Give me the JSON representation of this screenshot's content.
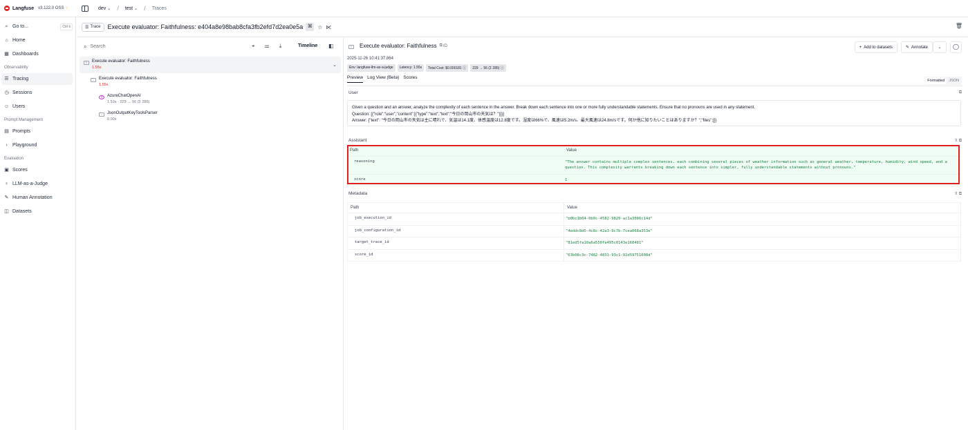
{
  "app": {
    "name": "Langfuse",
    "version": "v3.122.0 OSS",
    "version_dot": "↑",
    "breadcrumb": {
      "project": "dev",
      "env": "test",
      "page": "Traces"
    }
  },
  "sidebar": {
    "goto": {
      "label": "Go to...",
      "shortcut": "Ctrl k"
    },
    "top": [
      {
        "label": "Home",
        "icon": "home-icon"
      },
      {
        "label": "Dashboards",
        "icon": "dashboard-icon"
      }
    ],
    "sections": [
      {
        "title": "Observability",
        "items": [
          {
            "label": "Tracing",
            "icon": "tracing-icon",
            "active": true
          },
          {
            "label": "Sessions",
            "icon": "sessions-icon"
          },
          {
            "label": "Users",
            "icon": "users-icon"
          }
        ]
      },
      {
        "title": "Prompt Management",
        "items": [
          {
            "label": "Prompts",
            "icon": "prompts-icon"
          },
          {
            "label": "Playground",
            "icon": "playground-icon"
          }
        ]
      },
      {
        "title": "Evaluation",
        "items": [
          {
            "label": "Scores",
            "icon": "scores-icon"
          },
          {
            "label": "LLM-as-a-Judge",
            "icon": "judge-icon"
          },
          {
            "label": "Human Annotation",
            "icon": "annotation-icon"
          },
          {
            "label": "Datasets",
            "icon": "datasets-icon"
          }
        ]
      }
    ]
  },
  "trace": {
    "badge": "Trace",
    "title": "Execute evaluator: Faithfulness: e404a8e98bab8cfa3fb2efd7d2ea0e5a"
  },
  "tree": {
    "search_placeholder": "Search",
    "timeline_label": "Timeline",
    "nodes": [
      {
        "name": "Execute evaluator: Faithfulness",
        "meta": "1.55s"
      },
      {
        "name": "Execute evaluator: Faithfulness",
        "meta": "1.55s"
      },
      {
        "name": "AzureChatOpenAI",
        "meta": "1.53s · 229 → 56 (Σ 285)"
      },
      {
        "name": "JsonOutputKeyToolsParser",
        "meta": "0.00s"
      }
    ]
  },
  "detail": {
    "title": "Execute evaluator: Faithfulness",
    "title_suffix": "ID",
    "timestamp": "2025-11-26 10:41:37.864",
    "chips": [
      "Env: langfuse-llm-as-a-judge",
      "Latency: 1.55s",
      "Total Cost: $0.000181 ⓘ",
      "229 → 56 (Σ 285) ⓘ"
    ],
    "buttons": {
      "add_to_datasets": "Add to datasets",
      "annotate": "Annotate"
    },
    "tabs": [
      "Preview",
      "Log View (Beta)",
      "Scores"
    ],
    "format": {
      "formatted": "Formatted",
      "json": "JSON"
    },
    "user": {
      "label": "User",
      "line1": "Given a question and an answer, analyze the complexity of each sentence in the answer. Break down each sentence into one or more fully understandable statements. Ensure that no pronouns are used in any statement.",
      "line2": "Question: [{\"role\":\"user\",\"content\":[{\"type\":\"text\",\"text\":\"今日の岡山市の天気は？\"}]}]",
      "line3": "Answer: {\"text\": \"今日の岡山市の天気は主に晴れで、気温は14.1度、体感温度は12.8度です。湿度は66%で、風速は5.2m/s、最大風速は24.8m/sです。何か他に知りたいことはありますか？\",\"files\":[]}"
    },
    "assistant": {
      "label": "Assistant",
      "headers": {
        "path": "Path",
        "value": "Value"
      },
      "rows": [
        {
          "path": "reasoning",
          "value": "\"The answer contains multiple complex sentences, each combining several pieces of weather information such as general weather, temperature, humidity, wind speed, and a question. This complexity warrants breaking down each sentence into simpler, fully understandable statements without pronouns.\""
        },
        {
          "path": "score",
          "value": "1"
        }
      ]
    },
    "metadata": {
      "label": "Metadata",
      "headers": {
        "path": "Path",
        "value": "Value"
      },
      "rows": [
        {
          "path": "job_execution_id",
          "value": "\"b0bc1b04-0b0c-4582-9820-ac1a3086c14d\""
        },
        {
          "path": "job_configuration_id",
          "value": "\"4eddc8d5-4c8c-42a3-9c7b-7cea068a353e\""
        },
        {
          "path": "target_trace_id",
          "value": "\"81ed5fa10a6a550fa495c0143e168481\""
        },
        {
          "path": "score_id",
          "value": "\"63b08c3c-7482-4831-93c1-92d59751008d\""
        }
      ]
    }
  },
  "colors": {
    "accent_red": "#e11d1d",
    "value_green": "#15803d",
    "highlight_bg": "#f0fdf4"
  }
}
